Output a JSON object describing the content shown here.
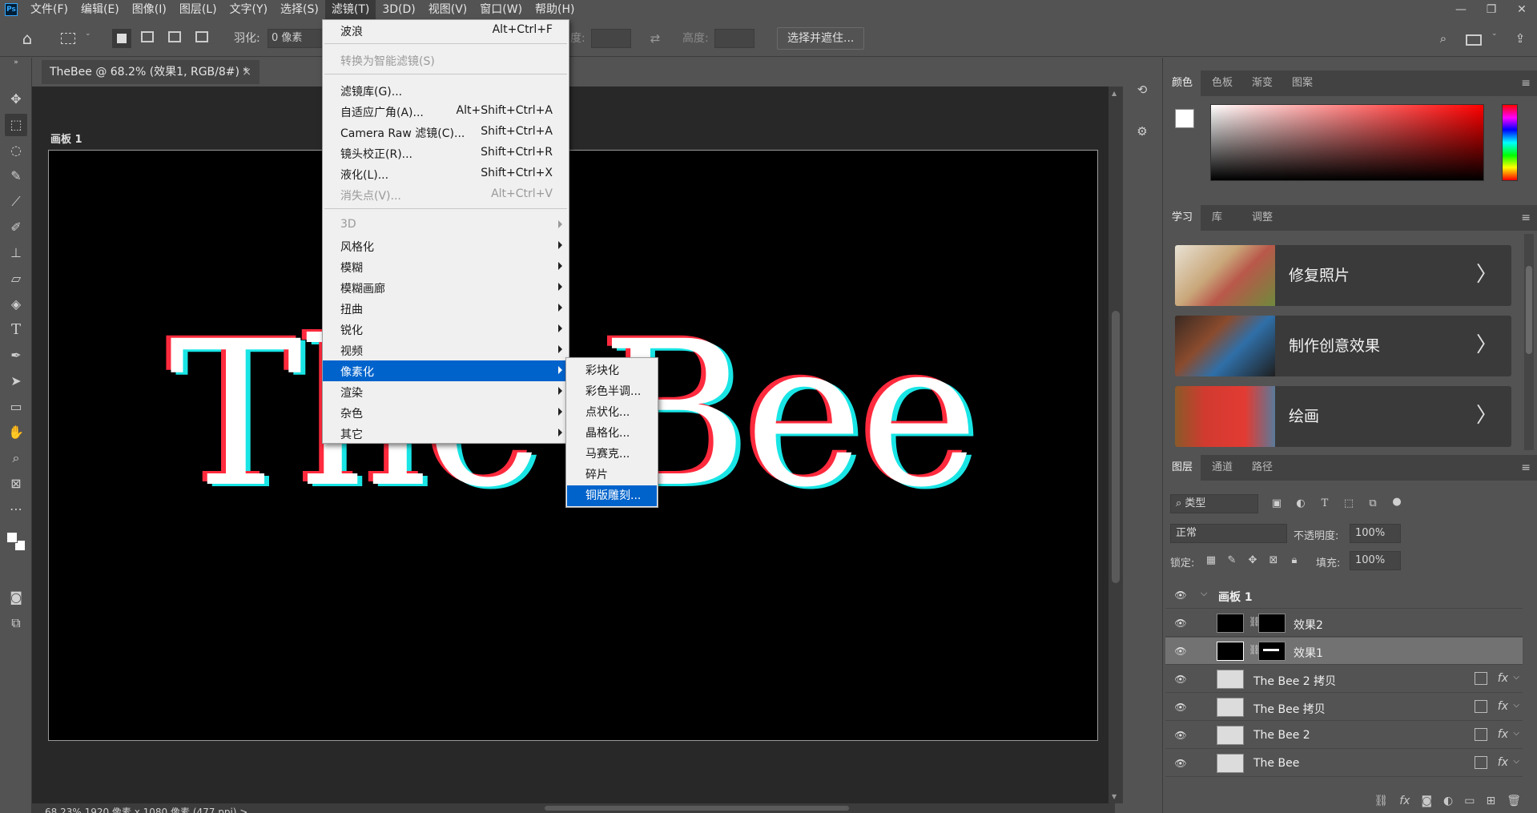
{
  "menubar": {
    "items": [
      "文件(F)",
      "编辑(E)",
      "图像(I)",
      "图层(L)",
      "文字(Y)",
      "选择(S)",
      "滤镜(T)",
      "3D(D)",
      "视图(V)",
      "窗口(W)",
      "帮助(H)"
    ],
    "active": "滤镜(T)",
    "window_controls": [
      "—",
      "❐",
      "✕"
    ]
  },
  "options_bar": {
    "feather_label": "羽化:",
    "feather_value": "0 像素",
    "width_label_partial": "度:",
    "height_label": "高度:",
    "select_mask_button": "选择并遮住..."
  },
  "document": {
    "tab_title": "TheBee @ 68.2% (效果1, RGB/8#) *",
    "tab_close": "×",
    "artboard_label": "画板 1",
    "canvas_text": "The Bee",
    "status": "68.23%    1920 像素 x 1080 像素 (477 ppi)    >"
  },
  "filter_menu": {
    "items": [
      {
        "label": "波浪",
        "shortcut": "Alt+Ctrl+F",
        "disabled": false,
        "submenu": false
      },
      {
        "label": "转换为智能滤镜(S)",
        "shortcut": "",
        "disabled": true,
        "submenu": false
      },
      {
        "label": "滤镜库(G)...",
        "shortcut": "",
        "disabled": false,
        "submenu": false
      },
      {
        "label": "自适应广角(A)...",
        "shortcut": "Alt+Shift+Ctrl+A",
        "disabled": false,
        "submenu": false
      },
      {
        "label": "Camera Raw 滤镜(C)...",
        "shortcut": "Shift+Ctrl+A",
        "disabled": false,
        "submenu": false
      },
      {
        "label": "镜头校正(R)...",
        "shortcut": "Shift+Ctrl+R",
        "disabled": false,
        "submenu": false
      },
      {
        "label": "液化(L)...",
        "shortcut": "Shift+Ctrl+X",
        "disabled": false,
        "submenu": false
      },
      {
        "label": "消失点(V)...",
        "shortcut": "Alt+Ctrl+V",
        "disabled": true,
        "submenu": false
      },
      {
        "label": "3D",
        "shortcut": "",
        "disabled": true,
        "submenu": true
      },
      {
        "label": "风格化",
        "shortcut": "",
        "disabled": false,
        "submenu": true
      },
      {
        "label": "模糊",
        "shortcut": "",
        "disabled": false,
        "submenu": true
      },
      {
        "label": "模糊画廊",
        "shortcut": "",
        "disabled": false,
        "submenu": true
      },
      {
        "label": "扭曲",
        "shortcut": "",
        "disabled": false,
        "submenu": true
      },
      {
        "label": "锐化",
        "shortcut": "",
        "disabled": false,
        "submenu": true
      },
      {
        "label": "视频",
        "shortcut": "",
        "disabled": false,
        "submenu": true
      },
      {
        "label": "像素化",
        "shortcut": "",
        "disabled": false,
        "submenu": true,
        "highlighted": true
      },
      {
        "label": "渲染",
        "shortcut": "",
        "disabled": false,
        "submenu": true
      },
      {
        "label": "杂色",
        "shortcut": "",
        "disabled": false,
        "submenu": true
      },
      {
        "label": "其它",
        "shortcut": "",
        "disabled": false,
        "submenu": true
      }
    ]
  },
  "pixelate_submenu": {
    "items": [
      "彩块化",
      "彩色半调...",
      "点状化...",
      "晶格化...",
      "马赛克...",
      "碎片",
      "铜版雕刻..."
    ],
    "highlighted": "铜版雕刻..."
  },
  "color_panel": {
    "tabs": [
      "颜色",
      "色板",
      "渐变",
      "图案"
    ],
    "active_tab": "颜色",
    "hue_color": "#ff0000",
    "fg_color": "#ffffff",
    "bg_color": "#ffffff"
  },
  "learn_panel": {
    "tabs": [
      "学习",
      "库",
      "调整"
    ],
    "active_tab": "学习",
    "cards": [
      {
        "title": "修复照片",
        "chevron": "〉"
      },
      {
        "title": "制作创意效果",
        "chevron": "〉"
      },
      {
        "title": "绘画",
        "chevron": "〉"
      }
    ]
  },
  "layers_panel": {
    "tabs": [
      "图层",
      "通道",
      "路径"
    ],
    "active_tab": "图层",
    "filter_kind": "类型",
    "blend_mode": "正常",
    "opacity_label": "不透明度:",
    "opacity_value": "100%",
    "lock_label": "锁定:",
    "fill_label": "填充:",
    "fill_value": "100%",
    "group_name": "画板 1",
    "layers": [
      {
        "name": "效果2",
        "type": "masked",
        "selected": false
      },
      {
        "name": "效果1",
        "type": "masked",
        "selected": true
      },
      {
        "name": "The Bee 2 拷贝",
        "type": "smart",
        "selected": false
      },
      {
        "name": "The Bee 拷贝",
        "type": "smart",
        "selected": false
      },
      {
        "name": "The Bee 2",
        "type": "smart",
        "selected": false
      },
      {
        "name": "The Bee",
        "type": "smart",
        "selected": false
      }
    ],
    "fx_label": "fx"
  }
}
